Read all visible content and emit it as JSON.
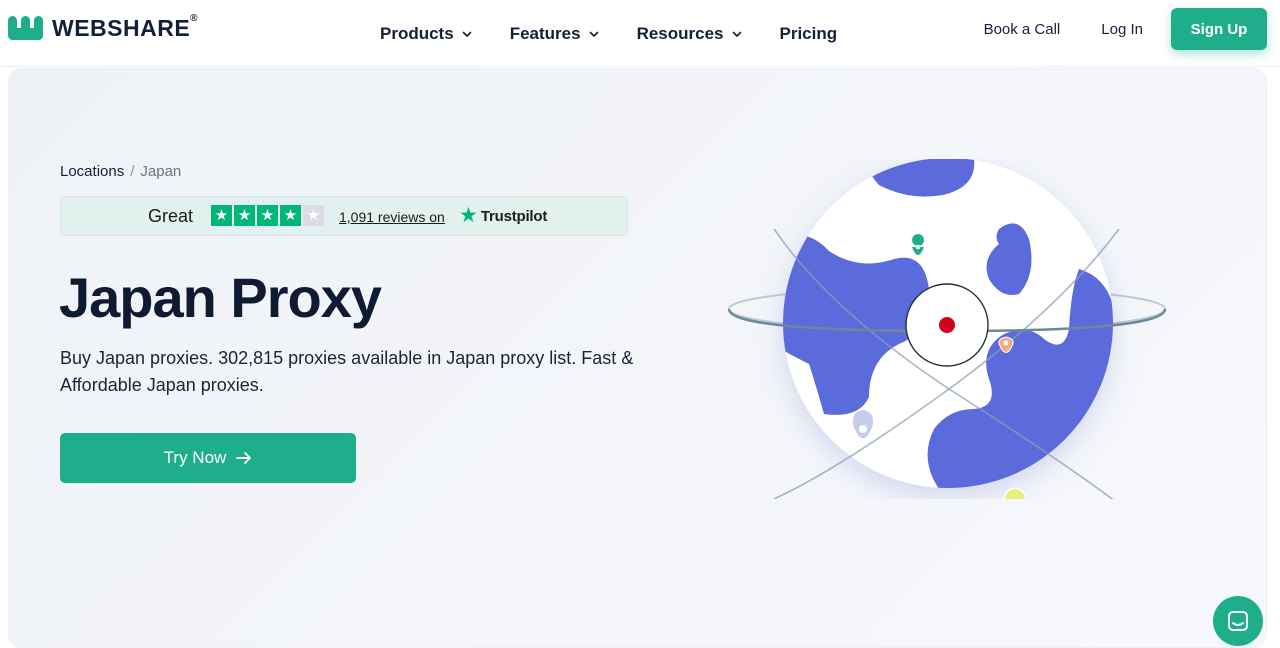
{
  "brand": {
    "name": "WEBSHARE",
    "registered": "®",
    "color": "#1fae8b"
  },
  "nav": {
    "items": [
      {
        "label": "Products",
        "icon": "chevron-down-icon"
      },
      {
        "label": "Features",
        "icon": "chevron-down-icon"
      },
      {
        "label": "Resources",
        "icon": "chevron-down-icon"
      },
      {
        "label": "Pricing"
      }
    ]
  },
  "header_actions": {
    "book_call": "Book a Call",
    "login": "Log In",
    "signup": "Sign Up"
  },
  "breadcrumb": {
    "root": "Locations",
    "separator": "/",
    "current": "Japan"
  },
  "trustpilot": {
    "rating_word": "Great",
    "stars_filled": 4,
    "stars_total": 5,
    "reviews_text": "1,091 reviews on",
    "brand": "Trustpilot",
    "star_color": "#00b67a"
  },
  "hero": {
    "title": "Japan Proxy",
    "description": "Buy Japan proxies. 302,815 proxies available in Japan proxy list. Fast & Affordable Japan proxies.",
    "cta_label": "Try Now",
    "cta_icon": "arrow-right-icon"
  },
  "illustration": {
    "icon": "globe-illustration",
    "land_color": "#5b6bdc",
    "pin_color": "#d0021b"
  },
  "chat_widget": {
    "icon": "chat-icon"
  }
}
